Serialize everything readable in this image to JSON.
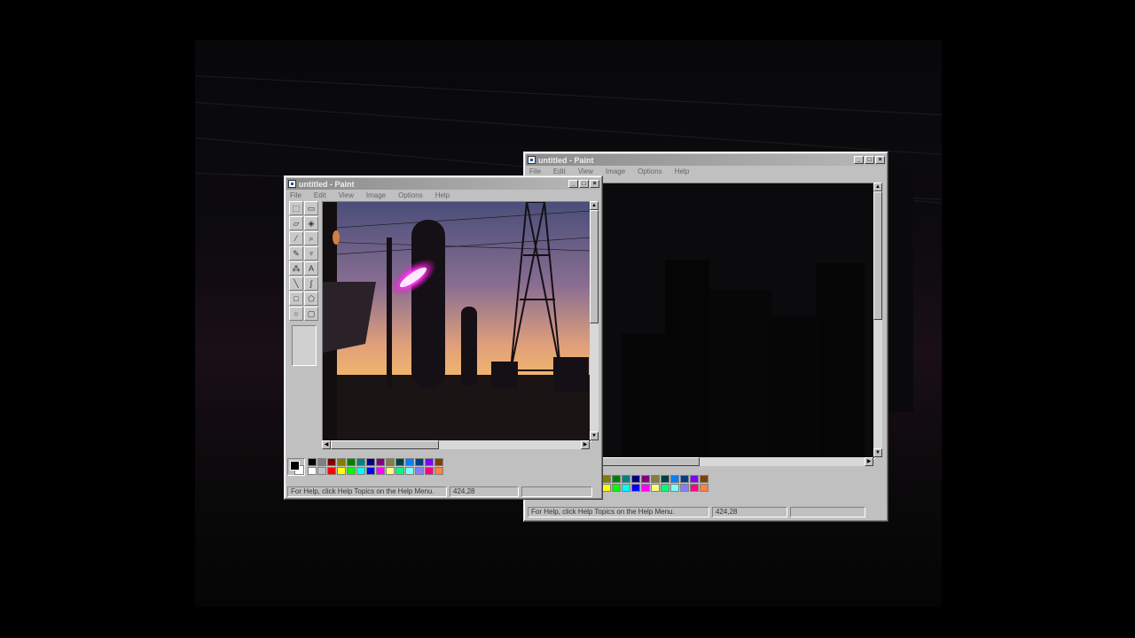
{
  "windows": {
    "front": {
      "title": "untitled - Paint",
      "menu": [
        "File",
        "Edit",
        "View",
        "Image",
        "Options",
        "Help"
      ],
      "status": {
        "help": "For Help, click Help Topics on the Help Menu.",
        "coords": "424,28"
      }
    },
    "back": {
      "title": "untitled - Paint",
      "menu": [
        "File",
        "Edit",
        "View",
        "Image",
        "Options",
        "Help"
      ],
      "status": {
        "help": "For Help, click Help Topics on the Help Menu.",
        "coords": "424,28"
      }
    }
  },
  "tools": [
    {
      "icon": "free-select-icon",
      "glyph": "⬚"
    },
    {
      "icon": "select-icon",
      "glyph": "▭"
    },
    {
      "icon": "eraser-icon",
      "glyph": "▱"
    },
    {
      "icon": "fill-icon",
      "glyph": "◈"
    },
    {
      "icon": "pick-color-icon",
      "glyph": "⁄"
    },
    {
      "icon": "magnifier-icon",
      "glyph": "⌕"
    },
    {
      "icon": "pencil-icon",
      "glyph": "✎"
    },
    {
      "icon": "brush-icon",
      "glyph": "♆"
    },
    {
      "icon": "airbrush-icon",
      "glyph": "⁂"
    },
    {
      "icon": "text-icon",
      "glyph": "A"
    },
    {
      "icon": "line-icon",
      "glyph": "╲"
    },
    {
      "icon": "curve-icon",
      "glyph": "∫"
    },
    {
      "icon": "rectangle-icon",
      "glyph": "□"
    },
    {
      "icon": "polygon-icon",
      "glyph": "⬠"
    },
    {
      "icon": "ellipse-icon",
      "glyph": "○"
    },
    {
      "icon": "rounded-rectangle-icon",
      "glyph": "▢"
    }
  ],
  "palette": [
    "#000000",
    "#808080",
    "#800000",
    "#808000",
    "#008000",
    "#008080",
    "#000080",
    "#800080",
    "#808040",
    "#004040",
    "#0080ff",
    "#004080",
    "#8000ff",
    "#804000",
    "#ffffff",
    "#c0c0c0",
    "#ff0000",
    "#ffff00",
    "#00ff00",
    "#00ffff",
    "#0000ff",
    "#ff00ff",
    "#ffff80",
    "#00ff80",
    "#80ffff",
    "#8080ff",
    "#ff0080",
    "#ff8040"
  ]
}
